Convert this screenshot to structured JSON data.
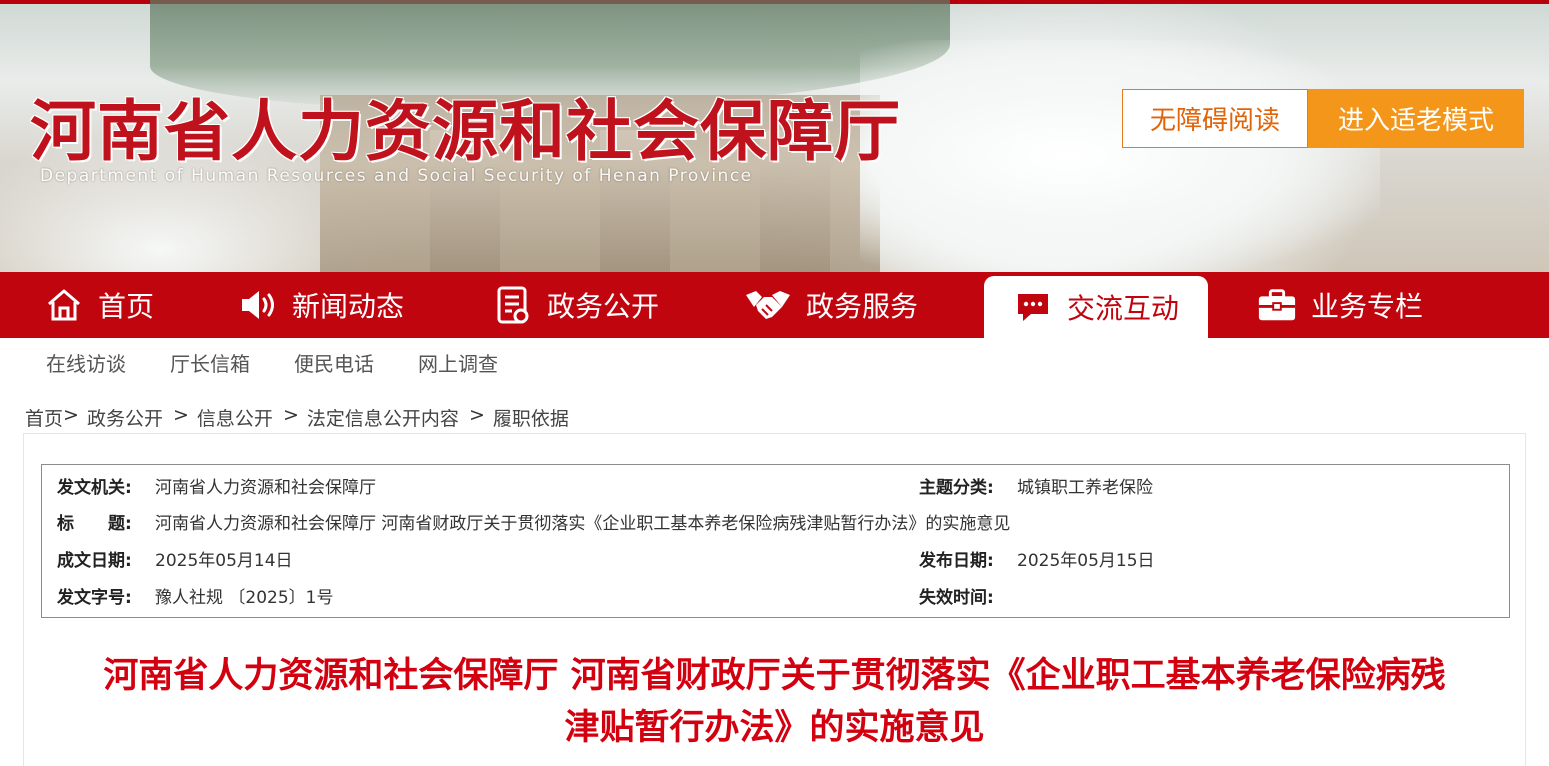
{
  "header": {
    "site_title": "河南省人力资源和社会保障厅",
    "site_subtitle": "Department of Human Resources and Social Security of Henan Province",
    "accessible_reading_label": "无障碍阅读",
    "elder_mode_label": "进入适老模式"
  },
  "main_nav": {
    "items": [
      {
        "label": "首页",
        "icon": "home-icon"
      },
      {
        "label": "新闻动态",
        "icon": "speaker-icon"
      },
      {
        "label": "政务公开",
        "icon": "document-icon"
      },
      {
        "label": "政务服务",
        "icon": "handshake-icon"
      },
      {
        "label": "交流互动",
        "icon": "chat-icon",
        "active": true
      },
      {
        "label": "业务专栏",
        "icon": "briefcase-icon"
      }
    ]
  },
  "sub_nav": {
    "items": [
      "在线访谈",
      "厅长信箱",
      "便民电话",
      "网上调查"
    ]
  },
  "breadcrumb": {
    "items": [
      "首页",
      "政务公开",
      "信息公开",
      "法定信息公开内容",
      "履职依据"
    ]
  },
  "meta": {
    "issuer_label": "发文机关:",
    "issuer_value": "河南省人力资源和社会保障厅",
    "category_label": "主题分类:",
    "category_value": "城镇职工养老保险",
    "title_label": "标　　题:",
    "title_value": "河南省人力资源和社会保障厅 河南省财政厅关于贯彻落实《企业职工基本养老保险病残津贴暂行办法》的实施意见",
    "written_date_label": "成文日期:",
    "written_date_value": "2025年05月14日",
    "publish_date_label": "发布日期:",
    "publish_date_value": "2025年05月15日",
    "doc_number_label": "发文字号:",
    "doc_number_value": "豫人社规 〔2025〕1号",
    "expiry_label": "失效时间:",
    "expiry_value": ""
  },
  "document": {
    "title_line1": "河南省人力资源和社会保障厅 河南省财政厅关于贯彻落实《企业职工基本养老保险病残",
    "title_line2": "津贴暂行办法》的实施意见"
  },
  "colors": {
    "brand_red": "#c0050f",
    "title_red": "#d3000f",
    "elder_orange": "#f39619",
    "access_orange": "#e0640a"
  }
}
